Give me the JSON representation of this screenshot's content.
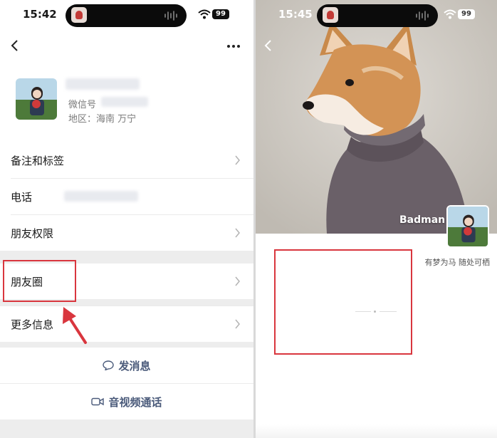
{
  "left_screen": {
    "status": {
      "time": "15:42",
      "battery": "99"
    },
    "profile": {
      "wechat_id_label": "微信号",
      "region": "地区：海南 万宁"
    },
    "rows": [
      {
        "label": "备注和标签"
      },
      {
        "label": "电话"
      },
      {
        "label": "朋友权限"
      },
      {
        "label": "朋友圈"
      },
      {
        "label": "更多信息"
      }
    ],
    "actions": {
      "message": "发消息",
      "video_call": "音视频通话"
    }
  },
  "right_screen": {
    "status": {
      "time": "15:45",
      "battery": "99"
    },
    "nickname": "Badman",
    "signature": "有梦为马 随处可栖"
  },
  "colors": {
    "highlight": "#d9363e",
    "action_text": "#4a5a7a",
    "page_bg": "#ededed"
  },
  "icons": [
    "back-icon",
    "more-icon",
    "chevron-right-icon",
    "chat-bubble-icon",
    "video-camera-icon",
    "wifi-icon",
    "battery-icon",
    "annotation-arrow"
  ]
}
